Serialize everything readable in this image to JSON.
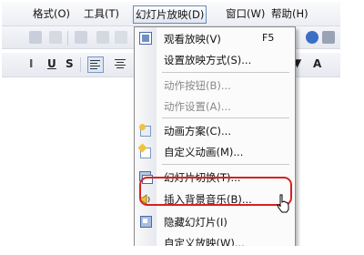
{
  "menubar": {
    "items": [
      "格式(O)",
      "工具(T)",
      "幻灯片放映(D)",
      "窗口(W)",
      "帮助(H)"
    ],
    "active": "幻灯片放映(D)"
  },
  "format_toolbar": {
    "underline": "U",
    "shadow": "S",
    "font_size_btn": "A"
  },
  "menu": {
    "items": [
      {
        "label": "观看放映(V)",
        "shortcut": "F5",
        "icon": "slideshow-icon"
      },
      {
        "label": "设置放映方式(S)...",
        "icon": ""
      },
      {
        "label": "动作按钮(B)...",
        "icon": "",
        "disabled": true
      },
      {
        "label": "动作设置(A)...",
        "icon": "",
        "disabled": true
      },
      {
        "label": "动画方案(C)...",
        "icon": "animation-scheme-icon"
      },
      {
        "label": "自定义动画(M)...",
        "icon": "custom-animation-icon"
      },
      {
        "label": "幻灯片切换(T)...",
        "icon": "slide-transition-icon"
      },
      {
        "label": "插入背景音乐(B)...",
        "icon": "speaker-icon"
      },
      {
        "label": "隐藏幻灯片(I)",
        "icon": "hide-slide-icon"
      },
      {
        "label": "自定义放映(W)...",
        "icon": ""
      }
    ]
  },
  "colors": {
    "highlight_circle": "#d92020",
    "menu_border": "#8a8a8a"
  }
}
